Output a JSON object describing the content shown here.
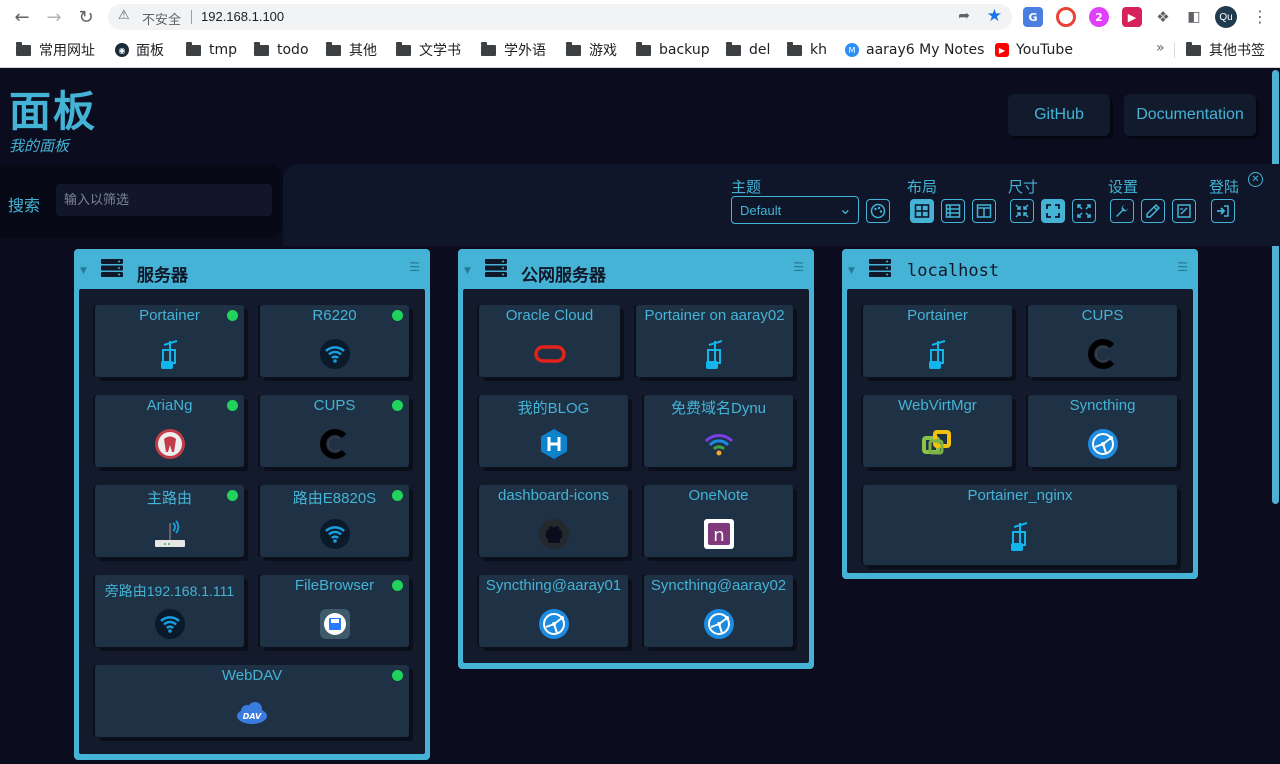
{
  "browser": {
    "security_label": "不安全",
    "url": "192.168.1.100",
    "profile_initials": "Qu",
    "bookmarks": [
      "常用网址",
      "面板",
      "tmp",
      "todo",
      "其他",
      "文学书",
      "学外语",
      "游戏",
      "backup",
      "del",
      "kh",
      "aaray6 My Notes",
      "YouTube"
    ],
    "bookmarks_more": "»",
    "other_bookmarks": "其他书签"
  },
  "header": {
    "title": "面板",
    "subtitle": "我的面板",
    "links": [
      "GitHub",
      "Documentation"
    ]
  },
  "search": {
    "label": "搜索",
    "placeholder": "输入以筛选"
  },
  "settings": {
    "theme_label": "主题",
    "theme_value": "Default",
    "layout_label": "布局",
    "size_label": "尺寸",
    "config_label": "设置",
    "login_label": "登陆"
  },
  "sections": [
    {
      "title": "服务器",
      "items": [
        {
          "name": "Portainer",
          "icon": "portainer-icon",
          "status": "online"
        },
        {
          "name": "R6220",
          "icon": "wifi-icon",
          "status": "online"
        },
        {
          "name": "AriaNg",
          "icon": "ariang-icon",
          "status": "online"
        },
        {
          "name": "CUPS",
          "icon": "cups-icon",
          "status": "online"
        },
        {
          "name": "主路由",
          "icon": "router-icon",
          "status": "online"
        },
        {
          "name": "路由E8820S",
          "icon": "wifi-icon",
          "status": "online"
        },
        {
          "name": "旁路由192.168.1.111",
          "icon": "wifi-icon",
          "status": ""
        },
        {
          "name": "FileBrowser",
          "icon": "filebrowser-icon",
          "status": "online"
        },
        {
          "name": "WebDAV",
          "icon": "webdav-icon",
          "status": "online"
        }
      ]
    },
    {
      "title": "公网服务器",
      "items": [
        {
          "name": "Oracle Cloud",
          "icon": "oracle-icon"
        },
        {
          "name": "Portainer on aaray02",
          "icon": "portainer-icon"
        },
        {
          "name": "我的BLOG",
          "icon": "hexo-icon"
        },
        {
          "name": "免费域名Dynu",
          "icon": "dynu-icon"
        },
        {
          "name": "dashboard-icons",
          "icon": "github-icon"
        },
        {
          "name": "OneNote",
          "icon": "onenote-icon"
        },
        {
          "name": "Syncthing@aaray01",
          "icon": "syncthing-icon"
        },
        {
          "name": "Syncthing@aaray02",
          "icon": "syncthing-icon"
        }
      ]
    },
    {
      "title": "localhost",
      "items": [
        {
          "name": "Portainer",
          "icon": "portainer-icon"
        },
        {
          "name": "CUPS",
          "icon": "cups-icon"
        },
        {
          "name": "WebVirtMgr",
          "icon": "webvirtmgr-icon"
        },
        {
          "name": "Syncthing",
          "icon": "syncthing-icon"
        },
        {
          "name": "Portainer_nginx",
          "icon": "portainer-icon"
        }
      ]
    }
  ],
  "colors": {
    "accent": "#44b3d6",
    "background": "#0b0c1d",
    "tile": "#1f3145",
    "status_online": "#20d35a"
  }
}
